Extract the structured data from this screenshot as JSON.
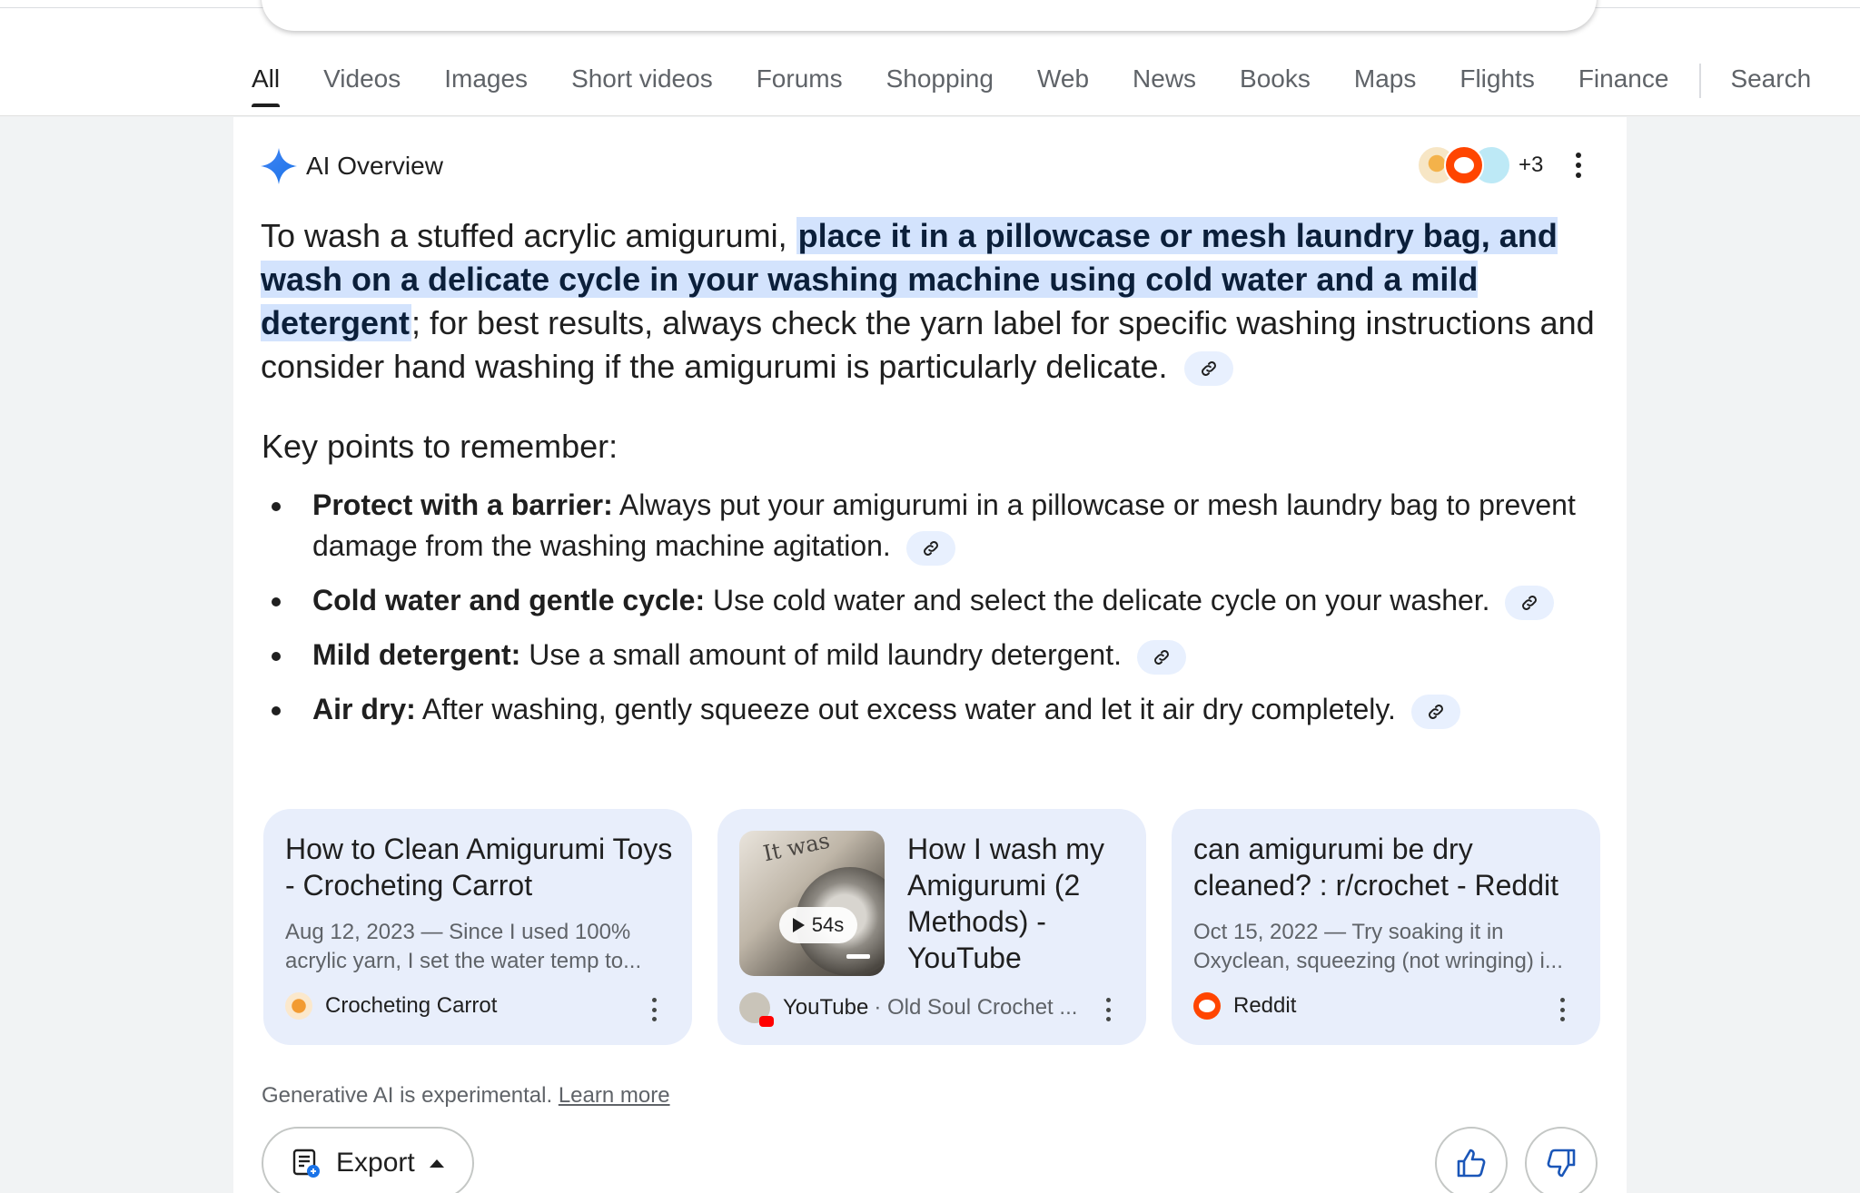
{
  "tabs": [
    {
      "label": "All",
      "active": true
    },
    {
      "label": "Videos"
    },
    {
      "label": "Images"
    },
    {
      "label": "Short videos"
    },
    {
      "label": "Forums"
    },
    {
      "label": "Shopping"
    },
    {
      "label": "Web"
    },
    {
      "label": "News"
    },
    {
      "label": "Books"
    },
    {
      "label": "Maps"
    },
    {
      "label": "Flights"
    },
    {
      "label": "Finance"
    },
    {
      "label": "Search"
    }
  ],
  "overview": {
    "title": "AI Overview",
    "source_count": "+3",
    "summary_before": "To wash a stuffed acrylic amigurumi, ",
    "summary_highlight": "place it in a pillowcase or mesh laundry bag, and wash on a delicate cycle in your washing machine using cold water and a mild detergent",
    "summary_after": "; for best results, always check the yarn label for specific washing instructions and consider hand washing if the amigurumi is particularly delicate.",
    "key_heading": "Key points to remember:",
    "points": [
      {
        "bold": "Protect with a barrier:",
        "text": " Always put your amigurumi in a pillowcase or mesh laundry bag to prevent damage from the washing machine agitation."
      },
      {
        "bold": "Cold water and gentle cycle:",
        "text": " Use cold water and select the delicate cycle on your washer."
      },
      {
        "bold": "Mild detergent:",
        "text": " Use a small amount of mild laundry detergent."
      },
      {
        "bold": "Air dry:",
        "text": " After washing, gently squeeze out excess water and let it air dry completely."
      }
    ]
  },
  "sources": [
    {
      "title": "How to Clean Amigurumi Toys - Crocheting Carrot",
      "snippet": "Aug 12, 2023 — Since I used 100% acrylic yarn, I set the water temp to...",
      "site": "Crocheting Carrot"
    },
    {
      "title": "How I wash my Amigurumi (2 Methods) - YouTube",
      "duration": "54s",
      "thumb_text": "It was",
      "site": "YouTube",
      "channel": "· Old Soul Crochet ..."
    },
    {
      "title": "can amigurumi be dry cleaned? : r/crochet - Reddit",
      "snippet": "Oct 15, 2022 — Try soaking it in Oxyclean, squeezing (not wringing) i...",
      "site": "Reddit"
    }
  ],
  "footer": {
    "disclaimer": "Generative AI is experimental.",
    "learn_more": "Learn more",
    "export_label": "Export"
  },
  "colors": {
    "highlight": "#d3e3fd",
    "source_card": "#e8eefb",
    "accent_blue": "#4285f4",
    "reddit_orange": "#ff4500"
  },
  "icons": [
    "ai-sparkle-icon",
    "more-vert-icon",
    "link-icon",
    "play-icon",
    "export-icon",
    "thumbs-up-icon",
    "thumbs-down-icon"
  ]
}
